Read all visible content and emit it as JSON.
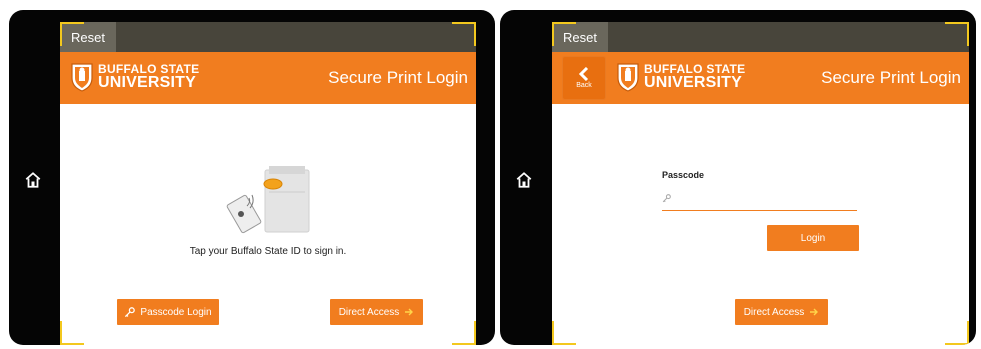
{
  "left_panel": {
    "reset_label": "Reset",
    "brand": {
      "line1": "BUFFALO STATE",
      "line2": "UNIVERSITY"
    },
    "title": "Secure Print Login",
    "instruction": "Tap your Buffalo State ID to sign in.",
    "passcode_login_label": "Passcode Login",
    "direct_access_label": "Direct Access"
  },
  "right_panel": {
    "reset_label": "Reset",
    "back_label": "Back",
    "brand": {
      "line1": "BUFFALO STATE",
      "line2": "UNIVERSITY"
    },
    "title": "Secure Print Login",
    "passcode_label": "Passcode",
    "passcode_value": "",
    "login_label": "Login",
    "direct_access_label": "Direct Access"
  },
  "icons": {
    "home": "home-icon",
    "key": "key-icon",
    "arrow": "arrow-right-icon",
    "back": "chevron-left-icon",
    "shield": "university-shield-icon"
  },
  "colors": {
    "accent": "#f17d1f",
    "topbar": "#48453b",
    "reset_button": "#6a675c",
    "corner_marks": "#f3c81e",
    "bezel": "#050505"
  }
}
